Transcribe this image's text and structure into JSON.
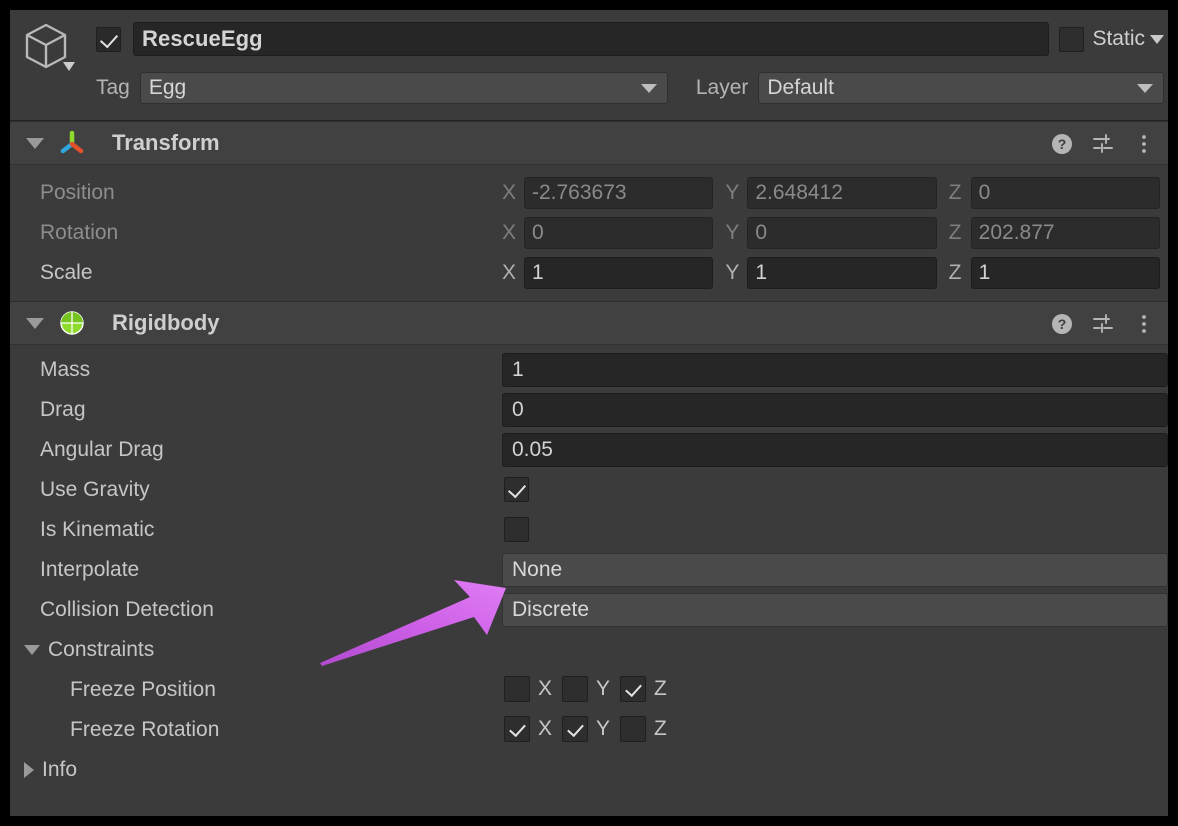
{
  "window": {
    "app": "Unity Editor",
    "panel": "Inspector"
  },
  "object_header": {
    "enabled_checkbox": true,
    "name": "RescueEgg",
    "static_label": "Static",
    "static_checked": false,
    "tag_label": "Tag",
    "tag_value": "Egg",
    "layer_label": "Layer",
    "layer_value": "Default",
    "prefab_icon": "gameobject-cube-icon"
  },
  "components": [
    {
      "name": "Transform",
      "icon": "transform-axis-icon",
      "expanded": true,
      "tools": [
        "help-icon",
        "preset-icon",
        "more-menu-icon"
      ],
      "rows": [
        {
          "label": "Position",
          "dim": true,
          "axes": [
            "X",
            "Y",
            "Z"
          ],
          "values": [
            "-2.763673",
            "2.648412",
            "0"
          ]
        },
        {
          "label": "Rotation",
          "dim": true,
          "axes": [
            "X",
            "Y",
            "Z"
          ],
          "values": [
            "0",
            "0",
            "202.877"
          ]
        },
        {
          "label": "Scale",
          "dim": false,
          "axes": [
            "X",
            "Y",
            "Z"
          ],
          "values": [
            "1",
            "1",
            "1"
          ]
        }
      ]
    },
    {
      "name": "Rigidbody",
      "icon": "rigidbody-icon",
      "expanded": true,
      "tools": [
        "help-icon",
        "preset-icon",
        "more-menu-icon"
      ],
      "rows": [
        {
          "label": "Mass",
          "type": "number",
          "value": "1"
        },
        {
          "label": "Drag",
          "type": "number",
          "value": "0"
        },
        {
          "label": "Angular Drag",
          "type": "number",
          "value": "0.05"
        },
        {
          "label": "Use Gravity",
          "type": "checkbox",
          "checked": true
        },
        {
          "label": "Is Kinematic",
          "type": "checkbox",
          "checked": false
        },
        {
          "label": "Interpolate",
          "type": "dropdown",
          "value": "None",
          "highlighted": true
        },
        {
          "label": "Collision Detection",
          "type": "dropdown",
          "value": "Discrete"
        }
      ],
      "constraints": {
        "label": "Constraints",
        "expanded": true,
        "freeze_position": {
          "label": "Freeze Position",
          "axes": [
            "X",
            "Y",
            "Z"
          ],
          "checked": [
            false,
            false,
            true
          ]
        },
        "freeze_rotation": {
          "label": "Freeze Rotation",
          "axes": [
            "X",
            "Y",
            "Z"
          ],
          "checked": [
            true,
            true,
            false
          ]
        }
      },
      "info": {
        "label": "Info",
        "expanded": false
      }
    }
  ],
  "annotation": {
    "type": "arrow",
    "color": "#d060e8",
    "points_to": "Interpolate dropdown",
    "from": [
      320,
      662
    ],
    "to": [
      505,
      590
    ]
  },
  "colors": {
    "panel_bg": "#3b3b3b",
    "header_bg": "#414141",
    "field_bg": "#262626",
    "dropdown_bg": "#4a4a4a",
    "text": "#c6c6c6",
    "text_dim": "#8d8d8d",
    "arrow": "#d060e8",
    "rigidbody_green": "#8ddb2c",
    "border": "#000000"
  }
}
